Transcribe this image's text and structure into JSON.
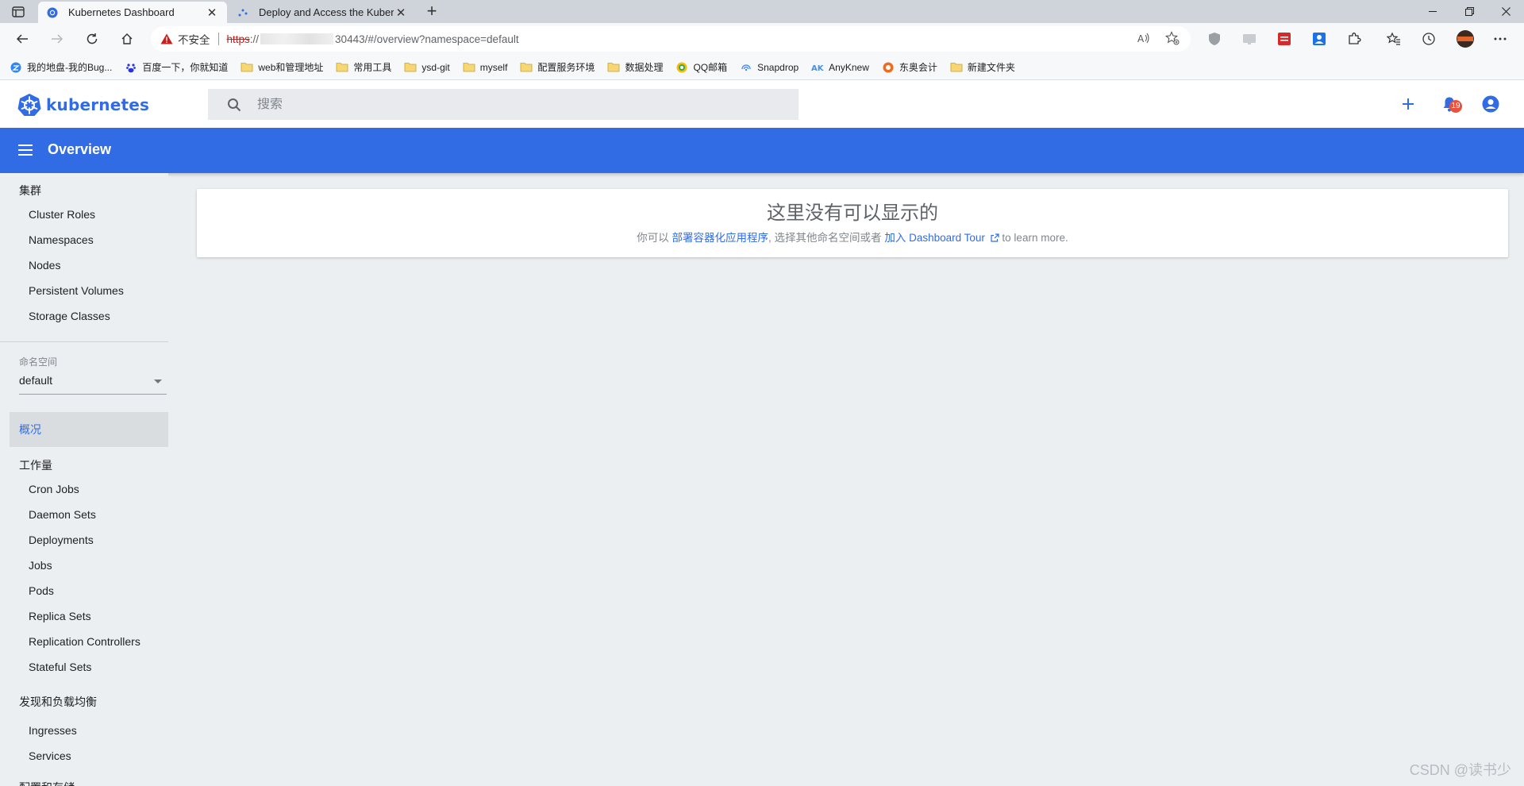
{
  "browser": {
    "tabs": [
      {
        "title": "Kubernetes Dashboard",
        "active": true
      },
      {
        "title": "Deploy and Access the Kubernetes Dashboard",
        "active": false
      }
    ],
    "address": {
      "security_label": "不安全",
      "scheme": "https",
      "scheme_suffix": "://",
      "rest": "30443/#/overview?namespace=default"
    },
    "bookmarks": [
      {
        "label": "我的地盘-我的Bug...",
        "icon": "zentao-icon"
      },
      {
        "label": "百度一下，你就知道",
        "icon": "baidu-icon"
      },
      {
        "label": "web和管理地址",
        "icon": "folder-icon"
      },
      {
        "label": "常用工具",
        "icon": "folder-icon"
      },
      {
        "label": "ysd-git",
        "icon": "folder-icon"
      },
      {
        "label": "myself",
        "icon": "folder-icon"
      },
      {
        "label": "配置服务环境",
        "icon": "folder-icon"
      },
      {
        "label": "数据处理",
        "icon": "folder-icon"
      },
      {
        "label": "QQ邮箱",
        "icon": "qqmail-icon"
      },
      {
        "label": "Snapdrop",
        "icon": "snapdrop-icon"
      },
      {
        "label": "AnyKnew",
        "icon": "anyknew-icon"
      },
      {
        "label": "东奥会计",
        "icon": "dongao-icon"
      },
      {
        "label": "新建文件夹",
        "icon": "folder-icon"
      }
    ]
  },
  "header": {
    "logo_text": "kubernetes",
    "search_placeholder": "搜索",
    "notification_count": "19"
  },
  "appbar": {
    "title": "Overview"
  },
  "sidebar": {
    "cluster": {
      "title": "集群",
      "items": [
        "Cluster Roles",
        "Namespaces",
        "Nodes",
        "Persistent Volumes",
        "Storage Classes"
      ]
    },
    "namespace": {
      "label": "命名空间",
      "value": "default"
    },
    "overview_label": "概况",
    "workloads": {
      "title": "工作量",
      "items": [
        "Cron Jobs",
        "Daemon Sets",
        "Deployments",
        "Jobs",
        "Pods",
        "Replica Sets",
        "Replication Controllers",
        "Stateful Sets"
      ]
    },
    "discovery": {
      "title": "发现和负载均衡",
      "items": [
        "Ingresses",
        "Services"
      ]
    },
    "config": {
      "title": "配置和存储"
    }
  },
  "main": {
    "empty_title": "这里没有可以显示的",
    "msg_prefix": "你可以",
    "deploy_link": "部署容器化应用程序",
    "msg_middle": ", 选择其他命名空间或者",
    "tour_link": "加入 Dashboard Tour",
    "msg_suffix": "to learn more."
  },
  "watermark": "CSDN @读书少",
  "colors": {
    "k8s_blue": "#326ce5",
    "badge_red": "#e8513d"
  }
}
